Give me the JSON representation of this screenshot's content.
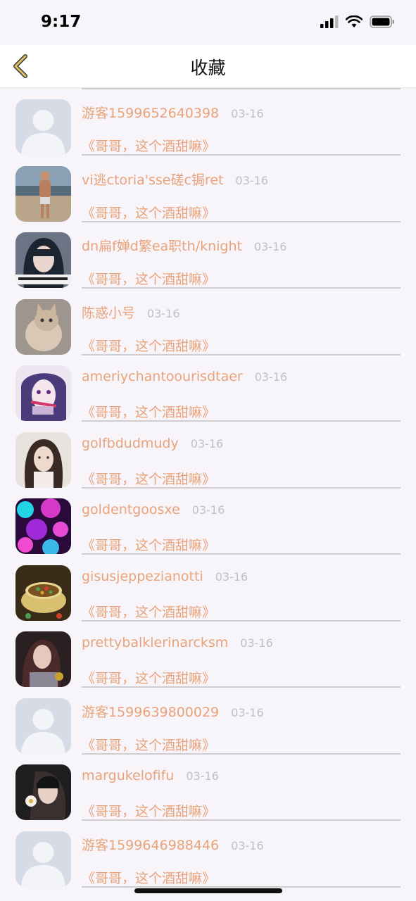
{
  "status_bar": {
    "time": "9:17",
    "icons": [
      "signal-icon",
      "wifi-icon",
      "battery-icon"
    ]
  },
  "nav": {
    "title": "收藏",
    "back_icon": "chevron-left-icon",
    "accent_color": "#e0c060"
  },
  "items": [
    {
      "name": "游客1599652640398",
      "date": "03-16",
      "quote": "《哥哥，这个酒甜嘛》",
      "avatar": "default-avatar"
    },
    {
      "name": "vi逃ctoria'sse磋c锔ret",
      "date": "03-16",
      "quote": "《哥哥，这个酒甜嘛》",
      "avatar": "photo-man-outdoors"
    },
    {
      "name": "dn扁f婵d繁ea职th/knight",
      "date": "03-16",
      "quote": "《哥哥，这个酒甜嘛》",
      "avatar": "photo-girl-blue-hair"
    },
    {
      "name": "陈惑小号",
      "date": "03-16",
      "quote": "《哥哥，这个酒甜嘛》",
      "avatar": "photo-kitten"
    },
    {
      "name": "ameriychantoourisdtaer",
      "date": "03-16",
      "quote": "《哥哥，这个酒甜嘛》",
      "avatar": "photo-anime"
    },
    {
      "name": "golfbdudmudy",
      "date": "03-16",
      "quote": "《哥哥，这个酒甜嘛》",
      "avatar": "photo-woman-portrait"
    },
    {
      "name": "goldentgoosxe",
      "date": "03-16",
      "quote": "《哥哥，这个酒甜嘛》",
      "avatar": "photo-bokeh-lights"
    },
    {
      "name": "gisusjeppezianotti",
      "date": "03-16",
      "quote": "《哥哥，这个酒甜嘛》",
      "avatar": "photo-tea-cup"
    },
    {
      "name": "prettybalklerinarcksm",
      "date": "03-16",
      "quote": "《哥哥，这个酒甜嘛》",
      "avatar": "photo-woman-dark"
    },
    {
      "name": "游客1599639800029",
      "date": "03-16",
      "quote": "《哥哥，这个酒甜嘛》",
      "avatar": "default-avatar"
    },
    {
      "name": "margukelofifu",
      "date": "03-16",
      "quote": "《哥哥，这个酒甜嘛》",
      "avatar": "photo-woman-flower"
    },
    {
      "name": "游客1599646988446",
      "date": "03-16",
      "quote": "《哥哥，这个酒甜嘛》",
      "avatar": "default-avatar"
    }
  ]
}
